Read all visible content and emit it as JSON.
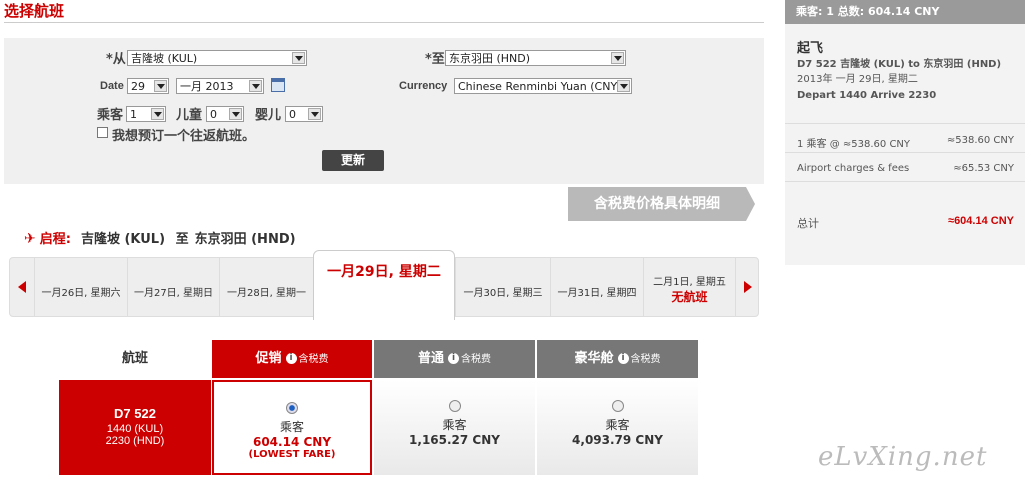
{
  "page": {
    "title": "选择航班"
  },
  "form": {
    "from_label": "*从",
    "from_value": "吉隆坡 (KUL)",
    "to_label": "*至",
    "to_value": "东京羽田 (HND)",
    "date_label": "Date",
    "date_day": "29",
    "date_month_year": "一月 2013",
    "currency_label": "Currency",
    "currency_value": "Chinese Renminbi Yuan (CNY)",
    "adult_label": "乘客",
    "adult_value": "1",
    "child_label": "儿童",
    "child_value": "0",
    "infant_label": "婴儿",
    "infant_value": "0",
    "return_label": "我想预订一个往返航班。",
    "update_button": "更新"
  },
  "tax_detail_button": "含税费价格具体明细",
  "route": {
    "depart_label": "启程:",
    "from": "吉隆坡 (KUL)",
    "to_word": "至",
    "to": "东京羽田 (HND)"
  },
  "dates": {
    "before": [
      "一月26日, 星期六",
      "一月27日, 星期日",
      "一月28日, 星期一"
    ],
    "selected": "一月29日, 星期二",
    "after": [
      "一月30日, 星期三",
      "一月31日, 星期四"
    ],
    "last_date": "二月1日, 星期五",
    "last_note": "无航班"
  },
  "fare_table": {
    "flight_header": "航班",
    "tax_note": "含税费",
    "columns": [
      {
        "name": "促销",
        "pax": "乘客",
        "price": "604.14 CNY",
        "note": "(LOWEST FARE)",
        "selected": true
      },
      {
        "name": "普通",
        "pax": "乘客",
        "price": "1,165.27 CNY",
        "selected": false
      },
      {
        "name": "豪华舱",
        "pax": "乘客",
        "price": "4,093.79 CNY",
        "selected": false
      }
    ],
    "flight": {
      "number": "D7  522",
      "dep": "1440  (KUL)",
      "arr": "2230  (HND)"
    }
  },
  "summary": {
    "header": "乘客: 1 总数: 604.14 CNY",
    "section": "起飞",
    "flight_line": "D7 522 吉隆坡 (KUL) to 东京羽田 (HND)",
    "date_line": "2013年 一月 29日, 星期二",
    "depart_label": "Depart",
    "depart_time": "1440",
    "arrive_label": "Arrive",
    "arrive_time": "2230",
    "pax_line": "1 乘客 @ ≈538.60 CNY",
    "pax_total": "≈538.60 CNY",
    "fees_label": "Airport charges & fees",
    "fees_value": "≈65.53 CNY",
    "total_label": "总计",
    "total_value": "≈604.14 CNY"
  },
  "watermark": "eLvXing.net",
  "colors": {
    "brand_red": "#cc0000",
    "gray_header": "#777777"
  }
}
